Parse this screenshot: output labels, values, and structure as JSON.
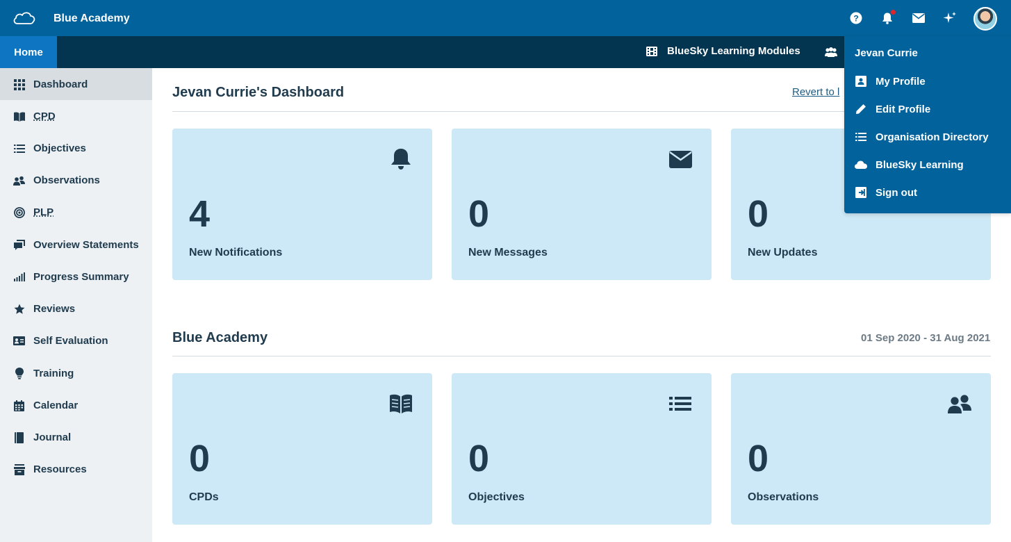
{
  "header": {
    "brand": "Blue Academy"
  },
  "nav": {
    "home_tab": "Home",
    "modules_link": "BlueSky Learning Modules"
  },
  "sidebar": {
    "items": [
      {
        "label": "Dashboard",
        "icon": "grid-icon",
        "active": true
      },
      {
        "label": "CPD",
        "icon": "book-icon"
      },
      {
        "label": "Objectives",
        "icon": "list-icon"
      },
      {
        "label": "Observations",
        "icon": "users-icon"
      },
      {
        "label": "PLP",
        "icon": "target-icon"
      },
      {
        "label": "Overview Statements",
        "icon": "comments-icon"
      },
      {
        "label": "Progress Summary",
        "icon": "bar-signal-icon"
      },
      {
        "label": "Reviews",
        "icon": "star-icon"
      },
      {
        "label": "Self Evaluation",
        "icon": "id-card-icon"
      },
      {
        "label": "Training",
        "icon": "lightbulb-icon"
      },
      {
        "label": "Calendar",
        "icon": "calendar-icon"
      },
      {
        "label": "Journal",
        "icon": "journal-icon"
      },
      {
        "label": "Resources",
        "icon": "archive-icon"
      }
    ]
  },
  "dashboard": {
    "title": "Jevan Currie's Dashboard",
    "revert_link": "Revert to l",
    "cards": [
      {
        "count": "4",
        "caption": "New Notifications",
        "icon": "bell-icon"
      },
      {
        "count": "0",
        "caption": "New Messages",
        "icon": "envelope-icon"
      },
      {
        "count": "0",
        "caption": "New Updates",
        "icon": "sparkle-icon"
      }
    ]
  },
  "academy": {
    "title": "Blue Academy",
    "date_range": "01 Sep 2020 - 31 Aug 2021",
    "cards": [
      {
        "count": "0",
        "caption": "CPDs",
        "icon": "book-open-icon"
      },
      {
        "count": "0",
        "caption": "Objectives",
        "icon": "list-icon"
      },
      {
        "count": "0",
        "caption": "Observations",
        "icon": "users-icon"
      }
    ]
  },
  "user_menu": {
    "user_name": "Jevan Currie",
    "items": [
      {
        "label": "My Profile",
        "icon": "profile-icon"
      },
      {
        "label": "Edit Profile",
        "icon": "pencil-icon"
      },
      {
        "label": "Organisation Directory",
        "icon": "list-icon"
      },
      {
        "label": "BlueSky Learning",
        "icon": "cloud-icon"
      },
      {
        "label": "Sign out",
        "icon": "sign-out-icon"
      }
    ]
  },
  "colors": {
    "topbar": "#02629b",
    "subnav": "#033550",
    "home_tab": "#0d75c1",
    "card": "#cde8f6",
    "text": "#1f3b4d",
    "sidebar": "#edf1f4",
    "notification_dot": "#e0262a"
  }
}
